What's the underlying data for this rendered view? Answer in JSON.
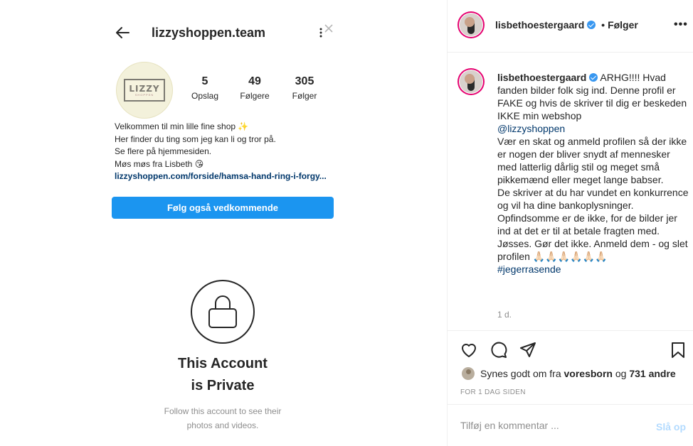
{
  "embedded_profile": {
    "username": "lizzyshoppen.team",
    "logo_text": "LIZZY",
    "logo_subtext": "SHOPPEN",
    "stats": [
      {
        "value": "5",
        "label": "Opslag"
      },
      {
        "value": "49",
        "label": "Følgere"
      },
      {
        "value": "305",
        "label": "Følger"
      }
    ],
    "bio_lines": [
      "Velkommen til min lille fine shop ✨",
      "Her finder du ting som jeg kan li og tror på.",
      "Se flere på hjemmesiden.",
      "Møs møs fra Lisbeth 😘"
    ],
    "bio_link": "lizzyshoppen.com/forside/hamsa-hand-ring-i-forgy...",
    "follow_button": "Følg også vedkommende",
    "private_title_line1": "This Account",
    "private_title_line2": "is Private",
    "private_sub_line1": "Follow this account to see their",
    "private_sub_line2": "photos and videos."
  },
  "post": {
    "header": {
      "username": "lisbethoestergaard",
      "dot": "•",
      "follow_label": "Følger",
      "more": "•••"
    },
    "caption": {
      "username": "lisbethoestergaard",
      "part1": "ARHG!!!! Hvad fanden bilder folk sig ind. Denne profil er FAKE og hvis de skriver til dig er beskeden IKKE min webshop",
      "mention": "@lizzyshoppen",
      "part2": "Vær en skat og anmeld profilen så der ikke er nogen der bliver snydt af mennesker med latterlig dårlig stil og meget små pikkemænd eller meget lange babser.",
      "part3": "De skriver at du har vundet en konkurrence og vil ha dine bankoplysninger. Opfindsomme er de ikke, for de bilder jer ind at det er til at betale fragten med. Jøsses. Gør det ikke. Anmeld dem - og slet profilen 🙏🏻🙏🏻🙏🏻🙏🏻🙏🏻🙏🏻",
      "hashtag": "#jegerrasende",
      "time": "1 d."
    },
    "likes": {
      "prefix": "Synes godt om fra",
      "liker": "voresborn",
      "middle": "og",
      "others": "731 andre"
    },
    "date": "FOR 1 DAG SIDEN",
    "comment": {
      "placeholder": "Tilføj en kommentar ...",
      "post_label": "Slå op"
    }
  }
}
